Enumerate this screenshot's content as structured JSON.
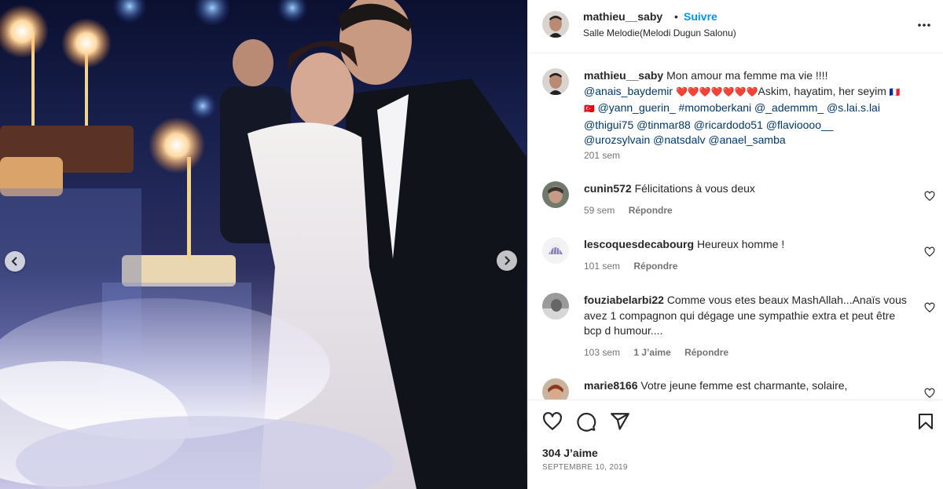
{
  "post": {
    "username": "mathieu__saby",
    "separator": "•",
    "follow_label": "Suivre",
    "location": "Salle Melodie(Melodi Dugun Salonu)"
  },
  "caption": {
    "username": "mathieu__saby",
    "text_start": "Mon amour ma femme ma vie !!!!",
    "mention_1": "@anais_baydemir",
    "hearts": "❤️❤️❤️❤️❤️❤️❤️",
    "text_mid": "Askim, hayatim, her seyim",
    "flag_fr": "🇫🇷",
    "flag_tr": "🇹🇷",
    "mentions_line": "@yann_guerin_ #momoberkani @_ademmm_ @s.lai.s.lai",
    "mentions_line2": "@thigui75 @tinmar88 @ricardodo51 @flavioooo__",
    "mentions_line3": "@urozsylvain @natsdalv @anael_samba",
    "time": "201 sem"
  },
  "comments": [
    {
      "username": "cunin572",
      "text": "Félicitations à vous deux",
      "time": "59 sem",
      "likes": "",
      "reply": "Répondre"
    },
    {
      "username": "lescoquesdecabourg",
      "text": "Heureux homme !",
      "time": "101 sem",
      "likes": "",
      "reply": "Répondre"
    },
    {
      "username": "fouziabelarbi22",
      "text": "Comme vous etes beaux MashAllah...Anaïs vous avez 1 compagnon qui dégage une sympathie extra et peut être bcp d humour....",
      "time": "103 sem",
      "likes": "1 J’aime",
      "reply": "Répondre"
    },
    {
      "username": "marie8166",
      "text": "Votre jeune femme est charmante, solaire,",
      "time": "",
      "likes": "",
      "reply": ""
    }
  ],
  "footer": {
    "likes": "304 J’aime",
    "date": "SEPTEMBRE 10, 2019"
  },
  "icons": {
    "like": "heart-icon",
    "comment": "comment-icon",
    "share": "share-icon",
    "save": "bookmark-icon",
    "more": "more-icon"
  },
  "colors": {
    "link": "#00376b",
    "follow": "#0095f6",
    "heart": "#ed4956"
  }
}
